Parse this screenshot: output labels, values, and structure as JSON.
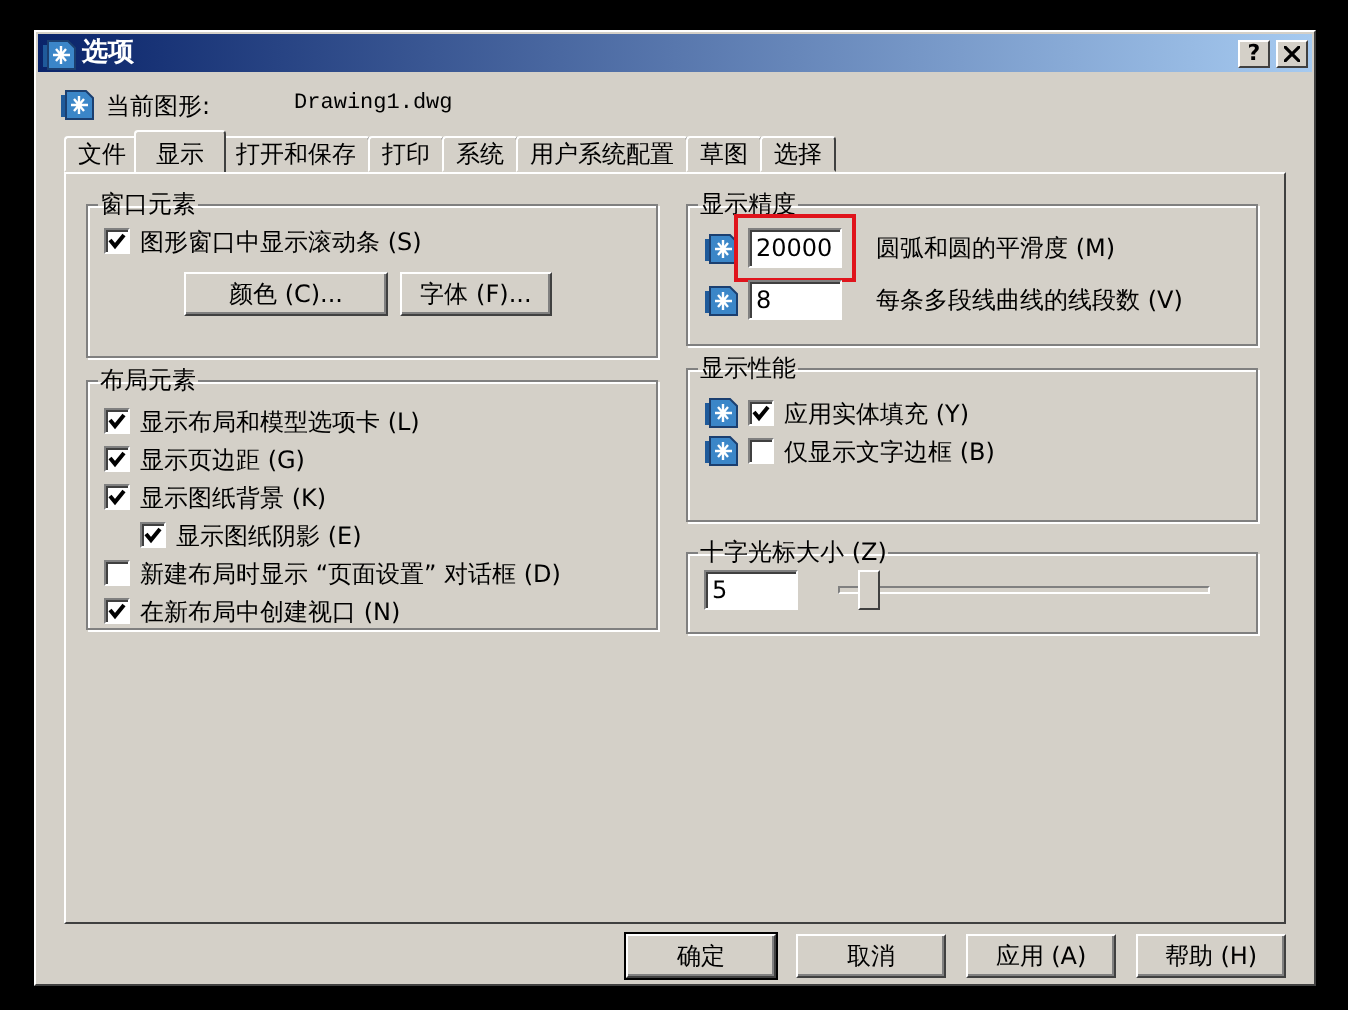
{
  "window": {
    "title": "选项",
    "help_button": "?"
  },
  "current_drawing": {
    "label": "当前图形:",
    "value": "Drawing1.dwg"
  },
  "tabs": [
    {
      "label": "文件",
      "selected": false
    },
    {
      "label": "显示",
      "selected": true
    },
    {
      "label": "打开和保存",
      "selected": false
    },
    {
      "label": "打印",
      "selected": false
    },
    {
      "label": "系统",
      "selected": false
    },
    {
      "label": "用户系统配置",
      "selected": false
    },
    {
      "label": "草图",
      "selected": false
    },
    {
      "label": "选择",
      "selected": false
    }
  ],
  "window_elements": {
    "title": "窗口元素",
    "checkboxes": [
      {
        "label": "图形窗口中显示滚动条 (S)",
        "checked": true
      }
    ],
    "buttons": [
      "颜色 (C)...",
      "字体 (F)..."
    ]
  },
  "layout_elements": {
    "title": "布局元素",
    "checkboxes": [
      {
        "label": "显示布局和模型选项卡 (L)",
        "checked": true
      },
      {
        "label": "显示页边距 (G)",
        "checked": true
      },
      {
        "label": "显示图纸背景 (K)",
        "checked": true,
        "children": [
          {
            "label": "显示图纸阴影 (E)",
            "checked": true
          }
        ]
      },
      {
        "label": "新建布局时显示 “页面设置” 对话框 (D)",
        "checked": false
      },
      {
        "label": "在新布局中创建视口 (N)",
        "checked": true
      }
    ]
  },
  "display_resolution": {
    "title": "显示精度",
    "fields": [
      {
        "value": "20000",
        "label": "圆弧和圆的平滑度 (M)",
        "highlighted": true
      },
      {
        "value": "8",
        "label": "每条多段线曲线的线段数 (V)",
        "highlighted": false
      }
    ]
  },
  "display_performance": {
    "title": "显示性能",
    "checkboxes": [
      {
        "label": "应用实体填充 (Y)",
        "checked": true
      },
      {
        "label": "仅显示文字边框 (B)",
        "checked": false
      }
    ]
  },
  "crosshair_size": {
    "title": "十字光标大小 (Z)",
    "value": "5",
    "level": 0.05
  },
  "buttons": [
    {
      "label": "确定",
      "default": true
    },
    {
      "label": "取消",
      "default": false
    },
    {
      "label": "应用 (A)",
      "default": false
    },
    {
      "label": "帮助 (H)",
      "default": false
    }
  ]
}
